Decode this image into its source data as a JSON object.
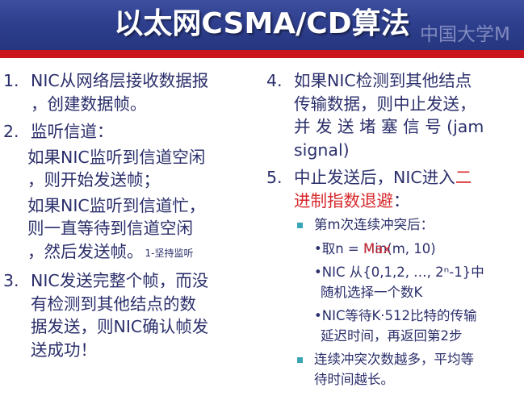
{
  "header": {
    "title": "以太网CSMA/CD算法",
    "watermark": "中国大学M"
  },
  "left": {
    "item1": {
      "num": "1.",
      "line1": "NIC从网络层接收数据报",
      "line2": "，创建数据帧。"
    },
    "item2": {
      "num": "2.",
      "line1": "监听信道：",
      "a1": "如果NIC监听到信道空闲",
      "a2": "，则开始发送帧；",
      "b1": "如果NIC监听到信道忙，",
      "b2": "则一直等待到信道空闲",
      "b3": "，然后发送帧。",
      "note": "1-坚持监听"
    },
    "item3": {
      "num": "3.",
      "line1": "NIC发送完整个帧，而没",
      "line2": "有检测到其他结点的数",
      "line3": "据发送，则NIC确认帧发",
      "line4": "送成功！"
    }
  },
  "right": {
    "item4": {
      "num": "4.",
      "line1": "如果NIC检测到其他结点",
      "line2": "传输数据，则中止发送，",
      "line3": "并 发 送 堵 塞 信 号 (jam",
      "line4": "signal)"
    },
    "item5": {
      "num": "5.",
      "line1a": "中止发送后，NIC进入",
      "line1b": "二",
      "line2": "进制指数退避",
      "line2c": "："
    },
    "bullet1": "第m次连续冲突后：",
    "sub1": {
      "prefix": "•取n = ",
      "overlay_red": "Max",
      "overlay_blue": "Min",
      "suffix": "(m, 10)"
    },
    "sub2": {
      "line1": "•NIC 从{0,1,2, …, 2ⁿ-1}中",
      "line2": "随机选择一个数K"
    },
    "sub3": {
      "line1": "•NIC等待K·512比特的传输",
      "line2": "延迟时间，再返回第2步"
    },
    "bullet2": {
      "line1": "连续冲突次数越多，平均等",
      "line2": "待时间越长。"
    }
  },
  "colors": {
    "header": "#2e3f8e",
    "accent_red": "#c9151b",
    "text": "#2b2f6b",
    "bullet": "#38a6b5"
  }
}
